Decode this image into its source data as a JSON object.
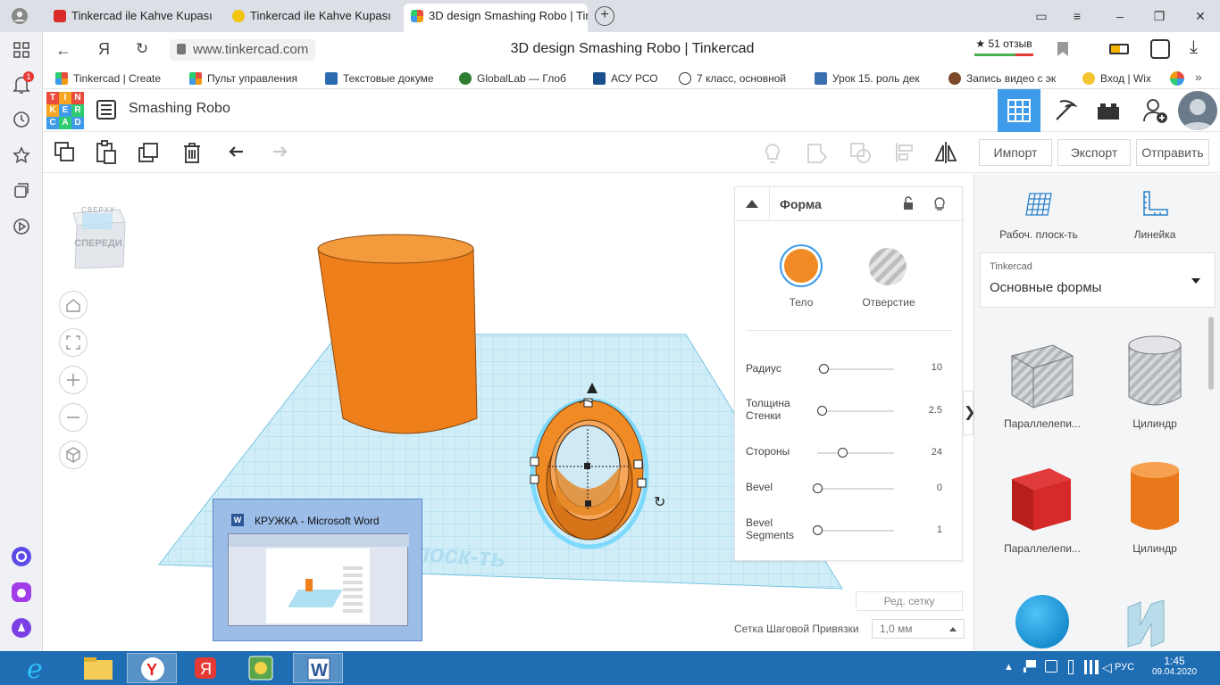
{
  "browser": {
    "tabs": [
      {
        "title": "Tinkercad ile Kahve Kupası",
        "fav_color": "#d92b2b"
      },
      {
        "title": "Tinkercad ile Kahve Kupası",
        "fav_color": "#f1c40f"
      },
      {
        "title": "3D design Smashing Robo | Tinkercad",
        "fav_color": "#3d9be9"
      }
    ],
    "url": "www.tinkercad.com",
    "page_title": "3D design Smashing Robo | Tinkercad",
    "rating": "★ 51 отзыв",
    "bookmarks": [
      {
        "label": "Tinkercad | Create",
        "color": "#e74c3c"
      },
      {
        "label": "Пульт управления",
        "color": "#e67e22"
      },
      {
        "label": "Текстовые докуме",
        "color": "#2b6cb0"
      },
      {
        "label": "GlobalLab — Глоб",
        "color": "#2e7d32"
      },
      {
        "label": "АСУ РСО",
        "color": "#1a4f8c"
      },
      {
        "label": "7 класс, основной",
        "color": "#333333"
      },
      {
        "label": "Урок 15. роль дек",
        "color": "#3a6fb0"
      },
      {
        "label": "Запись видео с эк",
        "color": "#7a4a2a"
      },
      {
        "label": "Вход | Wix",
        "color": "#f4c430"
      }
    ],
    "notification_badge": "1"
  },
  "app": {
    "logo_letters": [
      "T",
      "I",
      "N",
      "K",
      "E",
      "R",
      "C",
      "A",
      "D"
    ],
    "design_name": "Smashing Robo",
    "header_buttons": [
      "Импорт",
      "Экспорт",
      "Отправить"
    ],
    "view_cube_top": "СВЕРХУ",
    "view_cube_front": "СПЕРЕДИ",
    "workplane_watermark": "Рабоч. плоск-ть",
    "edit_grid": "Ред. сетку",
    "snap_label": "Сетка Шаговой Привязки",
    "snap_value": "1,0 мм"
  },
  "inspector": {
    "title": "Форма",
    "solid_label": "Тело",
    "hole_label": "Отверстие",
    "solid_color": "#f08a24",
    "props": [
      {
        "label": "Радиус",
        "value": "10",
        "pos": 0.08
      },
      {
        "label": "Толщина Стенки",
        "value": "2.5",
        "pos": 0.06
      },
      {
        "label": "Стороны",
        "value": "24",
        "pos": 0.32
      },
      {
        "label": "Bevel",
        "value": "0",
        "pos": 0.0
      },
      {
        "label": "Bevel Segments",
        "value": "1",
        "pos": 0.0
      }
    ]
  },
  "rightpanel": {
    "workplane_label": "Рабоч. плоск-ть",
    "ruler_label": "Линейка",
    "library_source": "Tinkercad",
    "library_name": "Основные формы",
    "shapes": [
      {
        "label": "Параллелепи...",
        "kind": "box-hole"
      },
      {
        "label": "Цилиндр",
        "kind": "cyl-hole"
      },
      {
        "label": "Параллелепи...",
        "kind": "box-red"
      },
      {
        "label": "Цилиндр",
        "kind": "cyl-orange"
      }
    ]
  },
  "word_preview": {
    "title": "КРУЖКА - Microsoft Word"
  },
  "taskbar": {
    "time": "1:45",
    "date": "09.04.2020",
    "lang": "РУС"
  }
}
